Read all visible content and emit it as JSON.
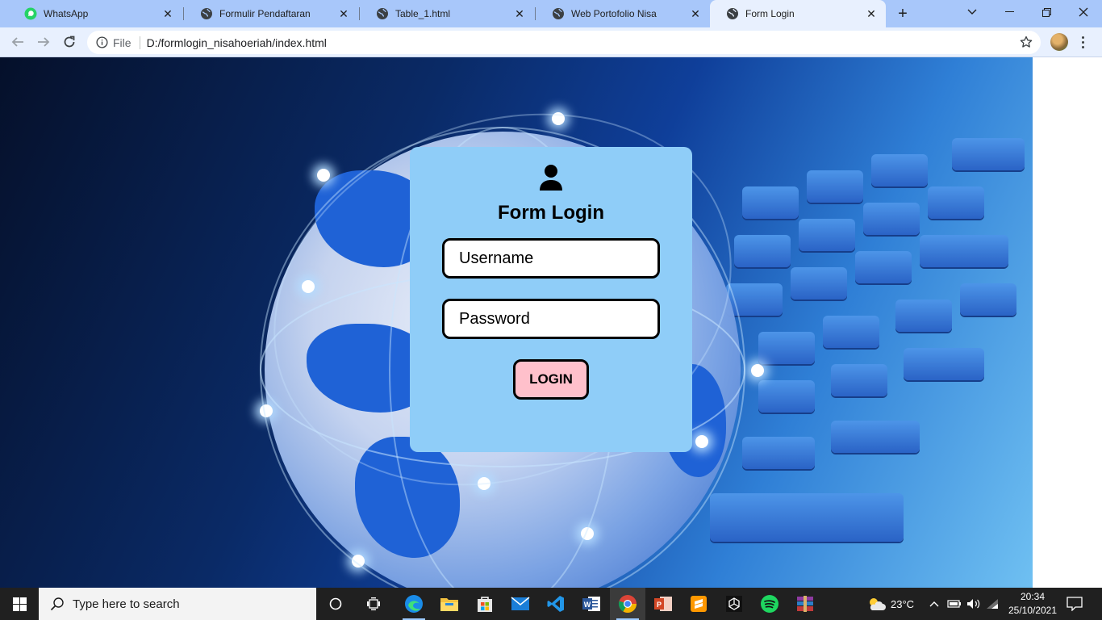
{
  "browser": {
    "tabs": [
      {
        "label": "WhatsApp",
        "icon": "whatsapp-icon"
      },
      {
        "label": "Formulir Pendaftaran",
        "icon": "globe-icon"
      },
      {
        "label": "Table_1.html",
        "icon": "globe-icon"
      },
      {
        "label": "Web Portofolio Nisa",
        "icon": "globe-icon"
      },
      {
        "label": "Form Login",
        "icon": "globe-icon",
        "active": true
      }
    ],
    "address": {
      "scheme_label": "File",
      "url": "D:/formlogin_nisahoeriah/index.html"
    }
  },
  "login": {
    "title": "Form Login",
    "username_placeholder": "Username",
    "password_placeholder": "Password",
    "button_label": "LOGIN",
    "colors": {
      "card": "#8fcdf8",
      "button": "#ffc0cb"
    }
  },
  "taskbar": {
    "search_placeholder": "Type here to search",
    "apps": [
      "task-view-icon",
      "widgets-icon",
      "edge-icon",
      "file-explorer-icon",
      "store-icon",
      "mail-icon",
      "vscode-icon",
      "word-icon",
      "chrome-icon",
      "powerpoint-icon",
      "sublime-icon",
      "unity-icon",
      "spotify-icon",
      "winrar-icon"
    ],
    "weather": "23°C",
    "time": "20:34",
    "date": "25/10/2021"
  }
}
